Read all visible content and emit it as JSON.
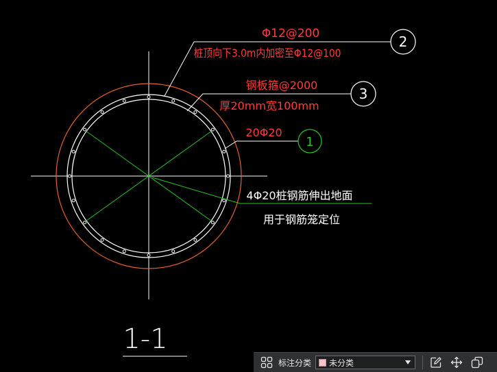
{
  "drawing": {
    "section_title": "1-1",
    "labels": {
      "l2_line1": "Φ12@200",
      "l2_line2": "桩顶向下3.0m内加密至Φ12@100",
      "l3_line1": "钢板箍@2000",
      "l3_line2": "厚20mm宽100mm",
      "l1_text": "20Φ20",
      "note_line1": "4Φ20桩钢筋伸出地面",
      "note_line2": "用于钢筋笼定位"
    },
    "bubbles": {
      "b1": "1",
      "b2": "2",
      "b3": "3"
    },
    "colors": {
      "background": "#000000",
      "outer_circle": "#e8612c",
      "rebar_circle": "#ffffff",
      "center_lines": "#ffffff",
      "positioning_bars": "#22c722",
      "label_red": "#ff3b3b",
      "label_white": "#ffffff",
      "leader_green": "#22c722"
    }
  },
  "toolbar": {
    "grid_icon": "grid-icon",
    "label": "标注分类",
    "select_value": "未分类",
    "select_swatch_color": "#f8c4cc",
    "edit_icon": "edit-icon",
    "move_icon": "move-icon",
    "copy_icon": "copy-icon"
  }
}
